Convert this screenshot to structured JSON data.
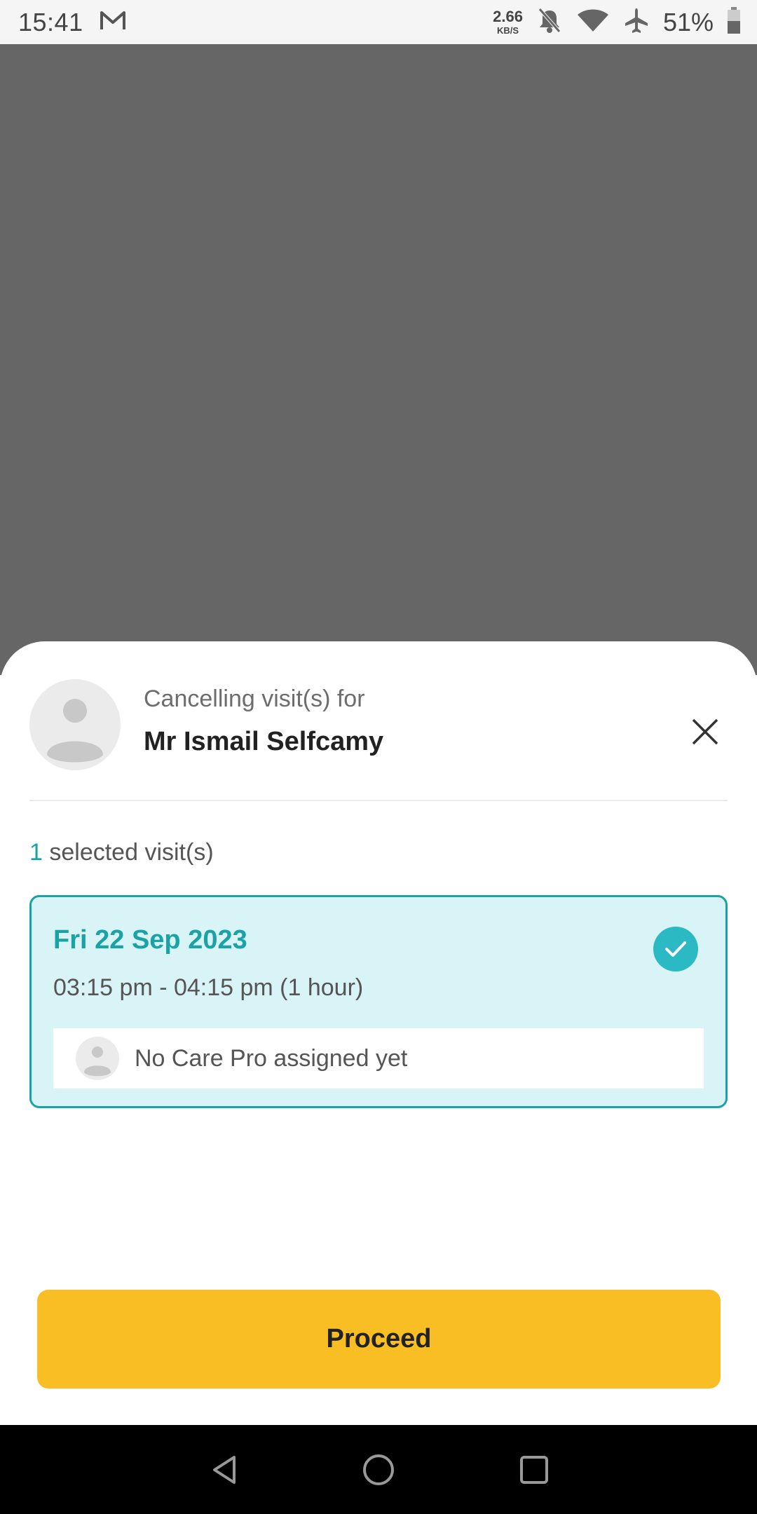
{
  "status_bar": {
    "time": "15:41",
    "net_speed_value": "2.66",
    "net_speed_unit": "KB/S",
    "battery_text": "51%",
    "icons": [
      "gmail-icon",
      "bell-off-icon",
      "wifi-icon",
      "airplane-icon",
      "battery-icon"
    ]
  },
  "sheet": {
    "subtitle": "Cancelling visit(s) for",
    "client_name": "Mr Ismail Selfcamy",
    "selected_count": "1",
    "selected_label": " selected visit(s)",
    "visit": {
      "date": "Fri 22 Sep 2023",
      "time": "03:15 pm - 04:15 pm (1 hour)",
      "carepro": "No Care Pro assigned yet",
      "selected": true
    },
    "proceed_label": "Proceed"
  },
  "colors": {
    "accent": "#1aa2a5",
    "card_background": "#d9f4f6",
    "button": "#f9be23",
    "overlay": "#666666"
  }
}
